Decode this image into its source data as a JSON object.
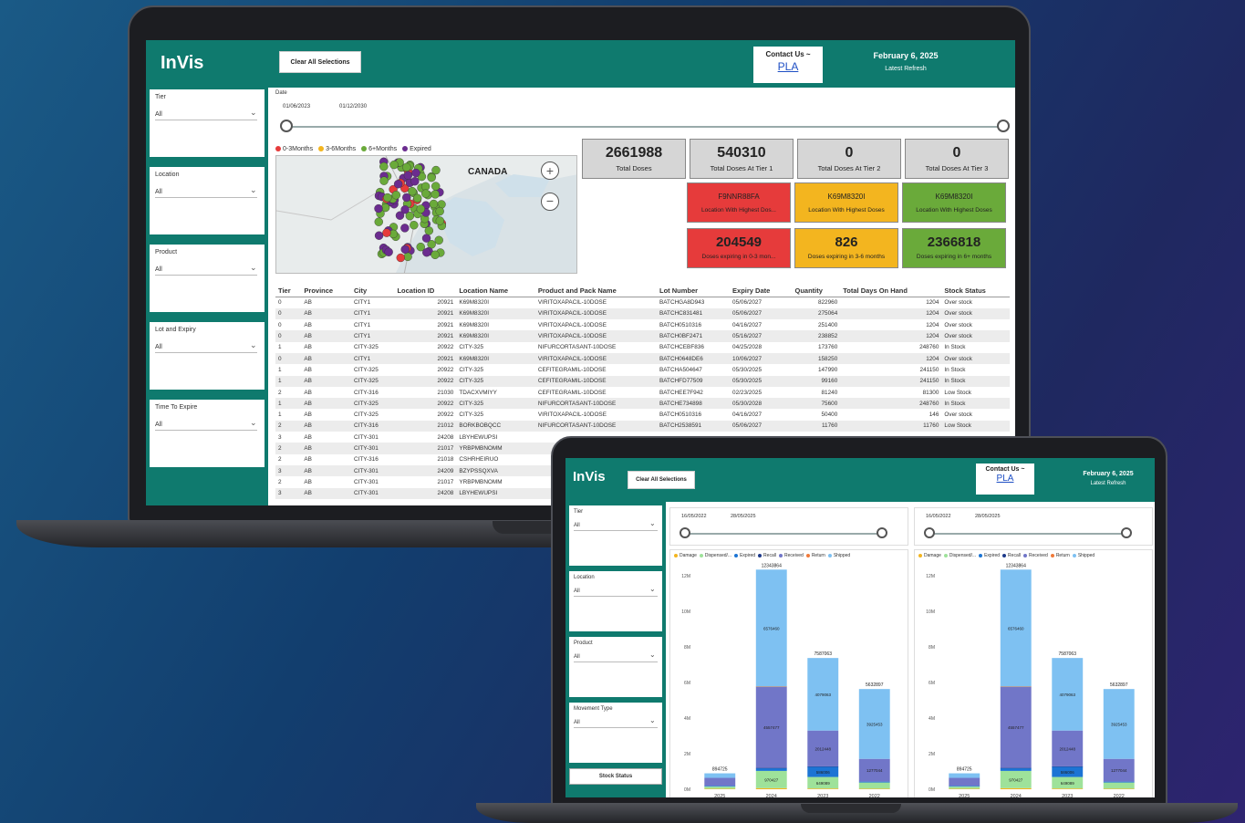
{
  "app": {
    "brand": "InVis",
    "clear_label": "Clear All Selections",
    "contact_label": "Contact Us ~",
    "contact_link": "PLA",
    "date": "February 6, 2025",
    "refresh_label": "Latest Refresh"
  },
  "big": {
    "slicers": [
      {
        "label": "Tier",
        "value": "All"
      },
      {
        "label": "Location",
        "value": "All"
      },
      {
        "label": "Product",
        "value": "All"
      },
      {
        "label": "Lot and Expiry",
        "value": "All"
      },
      {
        "label": "Time To Expire",
        "value": "All"
      }
    ],
    "date_slider": {
      "label": "Date",
      "start": "01/06/2023",
      "end": "01/12/2030"
    },
    "map": {
      "legend": [
        {
          "label": "0-3Months",
          "color": "#e63b3b"
        },
        {
          "label": "3-6Months",
          "color": "#f3b51f"
        },
        {
          "label": "6+Months",
          "color": "#6aaa3a"
        },
        {
          "label": "Expired",
          "color": "#6b2c8f"
        }
      ],
      "country_label": "CANADA"
    },
    "kpi_top": [
      {
        "value": "2661988",
        "caption": "Total Doses"
      },
      {
        "value": "540310",
        "caption": "Total Doses At Tier 1"
      },
      {
        "value": "0",
        "caption": "Total Doses At Tier 2"
      },
      {
        "value": "0",
        "caption": "Total Doses At Tier 3"
      }
    ],
    "kpi_location": [
      {
        "value": "F9NNR88FA",
        "caption": "Location With Highest Dos..."
      },
      {
        "value": "K69M8320I",
        "caption": "Location With Highest Doses"
      },
      {
        "value": "K69M8320I",
        "caption": "Location With Highest Doses"
      }
    ],
    "kpi_expiring": [
      {
        "value": "204549",
        "caption": "Doses expiring in 0-3 mon..."
      },
      {
        "value": "826",
        "caption": "Doses expiring in 3-6 months"
      },
      {
        "value": "2366818",
        "caption": "Doses expiring in 6+ months"
      }
    ],
    "table": {
      "columns": [
        "Tier",
        "Province",
        "City",
        "Location ID",
        "Location Name",
        "Product and Pack Name",
        "Lot Number",
        "Expiry Date",
        "Quantity",
        "Total Days On Hand",
        "Stock Status"
      ],
      "rows": [
        [
          "0",
          "AB",
          "CITY1",
          "20921",
          "K69M8320I",
          "VIRITOXAPACIL-10DOSE",
          "BATCHGA8D943",
          "05/06/2027",
          "822960",
          "1204",
          "Over stock"
        ],
        [
          "0",
          "AB",
          "CITY1",
          "20921",
          "K69M8320I",
          "VIRITOXAPACIL-10DOSE",
          "BATCHC831481",
          "05/06/2027",
          "275064",
          "1204",
          "Over stock"
        ],
        [
          "0",
          "AB",
          "CITY1",
          "20921",
          "K69M8320I",
          "VIRITOXAPACIL-10DOSE",
          "BATCH0510316",
          "04/16/2027",
          "251400",
          "1204",
          "Over stock"
        ],
        [
          "0",
          "AB",
          "CITY1",
          "20921",
          "K69M8320I",
          "VIRITOXAPACIL-10DOSE",
          "BATCH0BF2471",
          "05/16/2027",
          "238852",
          "1204",
          "Over stock"
        ],
        [
          "1",
          "AB",
          "CITY-325",
          "20922",
          "CITY-325",
          "NIFURCORTASANT-10DOSE",
          "BATCHCEBF836",
          "04/25/2028",
          "173760",
          "248760",
          "In Stock"
        ],
        [
          "0",
          "AB",
          "CITY1",
          "20921",
          "K69M8320I",
          "VIRITOXAPACIL-10DOSE",
          "BATCH0648DE6",
          "10/06/2027",
          "158250",
          "1204",
          "Over stock"
        ],
        [
          "1",
          "AB",
          "CITY-325",
          "20922",
          "CITY-325",
          "CEFITEGRAMIL-10DOSE",
          "BATCHA504647",
          "05/30/2025",
          "147990",
          "241150",
          "In Stock"
        ],
        [
          "1",
          "AB",
          "CITY-325",
          "20922",
          "CITY-325",
          "CEFITEGRAMIL-10DOSE",
          "BATCHFD77509",
          "05/30/2025",
          "99160",
          "241150",
          "In Stock"
        ],
        [
          "2",
          "AB",
          "CITY-316",
          "21030",
          "TDACXVMIYY",
          "CEFITEGRAMIL-10DOSE",
          "BATCHEE7F942",
          "02/23/2025",
          "81240",
          "81300",
          "Low Stock"
        ],
        [
          "1",
          "AB",
          "CITY-325",
          "20922",
          "CITY-325",
          "NIFURCORTASANT-10DOSE",
          "BATCHE734898",
          "05/30/2028",
          "75600",
          "248760",
          "In Stock"
        ],
        [
          "1",
          "AB",
          "CITY-325",
          "20922",
          "CITY-325",
          "VIRITOXAPACIL-10DOSE",
          "BATCH0510316",
          "04/16/2027",
          "50400",
          "146",
          "Over stock"
        ],
        [
          "2",
          "AB",
          "CITY-316",
          "21012",
          "BORKBOBQCC",
          "NIFURCORTASANT-10DOSE",
          "BATCH2538591",
          "05/06/2027",
          "11760",
          "11760",
          "Low Stock"
        ],
        [
          "3",
          "AB",
          "CITY-301",
          "24208",
          "LBYHEWUPSI",
          "",
          "",
          "",
          "",
          "",
          ""
        ],
        [
          "2",
          "AB",
          "CITY-301",
          "21017",
          "YRBPMBNOMM",
          "",
          "",
          "",
          "",
          "",
          ""
        ],
        [
          "2",
          "AB",
          "CITY-316",
          "21018",
          "CSHRHEIRUO",
          "",
          "",
          "",
          "",
          "",
          ""
        ],
        [
          "3",
          "AB",
          "CITY-301",
          "24209",
          "BZYPSSQXVA",
          "",
          "",
          "",
          "",
          "",
          ""
        ],
        [
          "2",
          "AB",
          "CITY-301",
          "21017",
          "YRBPMBNOMM",
          "",
          "",
          "",
          "",
          "",
          ""
        ],
        [
          "3",
          "AB",
          "CITY-301",
          "24208",
          "LBYHEWUPSI",
          "",
          "",
          "",
          "",
          "",
          ""
        ]
      ]
    }
  },
  "small": {
    "slicers": [
      {
        "label": "Tier",
        "value": "All"
      },
      {
        "label": "Location",
        "value": "All"
      },
      {
        "label": "Product",
        "value": "All"
      },
      {
        "label": "Movement Type",
        "value": "All"
      }
    ],
    "stock_button": "Stock Status",
    "sliders": [
      {
        "start": "16/05/2022",
        "end": "28/05/2025"
      },
      {
        "start": "16/05/2022",
        "end": "28/05/2025"
      }
    ]
  },
  "chart_data": [
    {
      "type": "bar",
      "stacked": true,
      "categories": [
        "2025",
        "2024",
        "2023",
        "2022"
      ],
      "ylim": [
        0,
        12000000
      ],
      "yticks": [
        "0M",
        "2M",
        "4M",
        "6M",
        "8M",
        "10M",
        "12M"
      ],
      "totals": [
        "894725",
        "12343864",
        "7587063",
        "5632897"
      ],
      "series": [
        {
          "name": "Damage",
          "color": "#f3b51f",
          "values": [
            30000,
            60000,
            40000,
            30000
          ]
        },
        {
          "name": "Dispensed/...",
          "color": "#9ee29a",
          "values": [
            120000,
            970427,
            649089,
            350000
          ]
        },
        {
          "name": "Expired",
          "color": "#1c74d4",
          "values": [
            40000,
            150000,
            586006,
            50000
          ]
        },
        {
          "name": "Recall",
          "color": "#1d3a8a",
          "values": [
            0,
            20000,
            10000,
            0
          ]
        },
        {
          "name": "Received",
          "color": "#7176c8",
          "values": [
            450000,
            4557477,
            2012448,
            1277044
          ]
        },
        {
          "name": "Return",
          "color": "#f07a3a",
          "values": [
            0,
            10000,
            0,
            0
          ]
        },
        {
          "name": "Shipped",
          "color": "#7ec1f2",
          "values": [
            254725,
            6576460,
            4079063,
            3925453
          ]
        }
      ],
      "segment_labels": {
        "2025": {},
        "2024": {
          "Dispensed/...": "970427",
          "Received": "4557477",
          "Shipped": "6576460"
        },
        "2023": {
          "Dispensed/...": "649089",
          "Expired": "586006",
          "Received": "2012448",
          "Shipped": "4079063"
        },
        "2022": {
          "Received": "1277044",
          "Shipped": "3925453"
        }
      }
    },
    {
      "type": "bar",
      "stacked": true,
      "categories": [
        "2025",
        "2024",
        "2023",
        "2022"
      ],
      "ylim": [
        0,
        12000000
      ],
      "yticks": [
        "0M",
        "2M",
        "4M",
        "6M",
        "8M",
        "10M",
        "12M"
      ],
      "totals": [
        "894725",
        "12343864",
        "7587063",
        "5632897"
      ],
      "series": [
        {
          "name": "Damage",
          "color": "#f3b51f",
          "values": [
            30000,
            60000,
            40000,
            30000
          ]
        },
        {
          "name": "Dispensed/...",
          "color": "#9ee29a",
          "values": [
            120000,
            970427,
            649089,
            350000
          ]
        },
        {
          "name": "Expired",
          "color": "#1c74d4",
          "values": [
            40000,
            150000,
            586006,
            50000
          ]
        },
        {
          "name": "Recall",
          "color": "#1d3a8a",
          "values": [
            0,
            20000,
            10000,
            0
          ]
        },
        {
          "name": "Received",
          "color": "#7176c8",
          "values": [
            450000,
            4557477,
            2012448,
            1277044
          ]
        },
        {
          "name": "Return",
          "color": "#f07a3a",
          "values": [
            0,
            10000,
            0,
            0
          ]
        },
        {
          "name": "Shipped",
          "color": "#7ec1f2",
          "values": [
            254725,
            6576460,
            4079063,
            3925453
          ]
        }
      ],
      "segment_labels": {
        "2025": {},
        "2024": {
          "Dispensed/...": "970427",
          "Received": "4557477",
          "Shipped": "6576460"
        },
        "2023": {
          "Dispensed/...": "649089",
          "Expired": "586006",
          "Received": "2012448",
          "Shipped": "4079063"
        },
        "2022": {
          "Received": "1277044",
          "Shipped": "3925453"
        }
      }
    }
  ]
}
